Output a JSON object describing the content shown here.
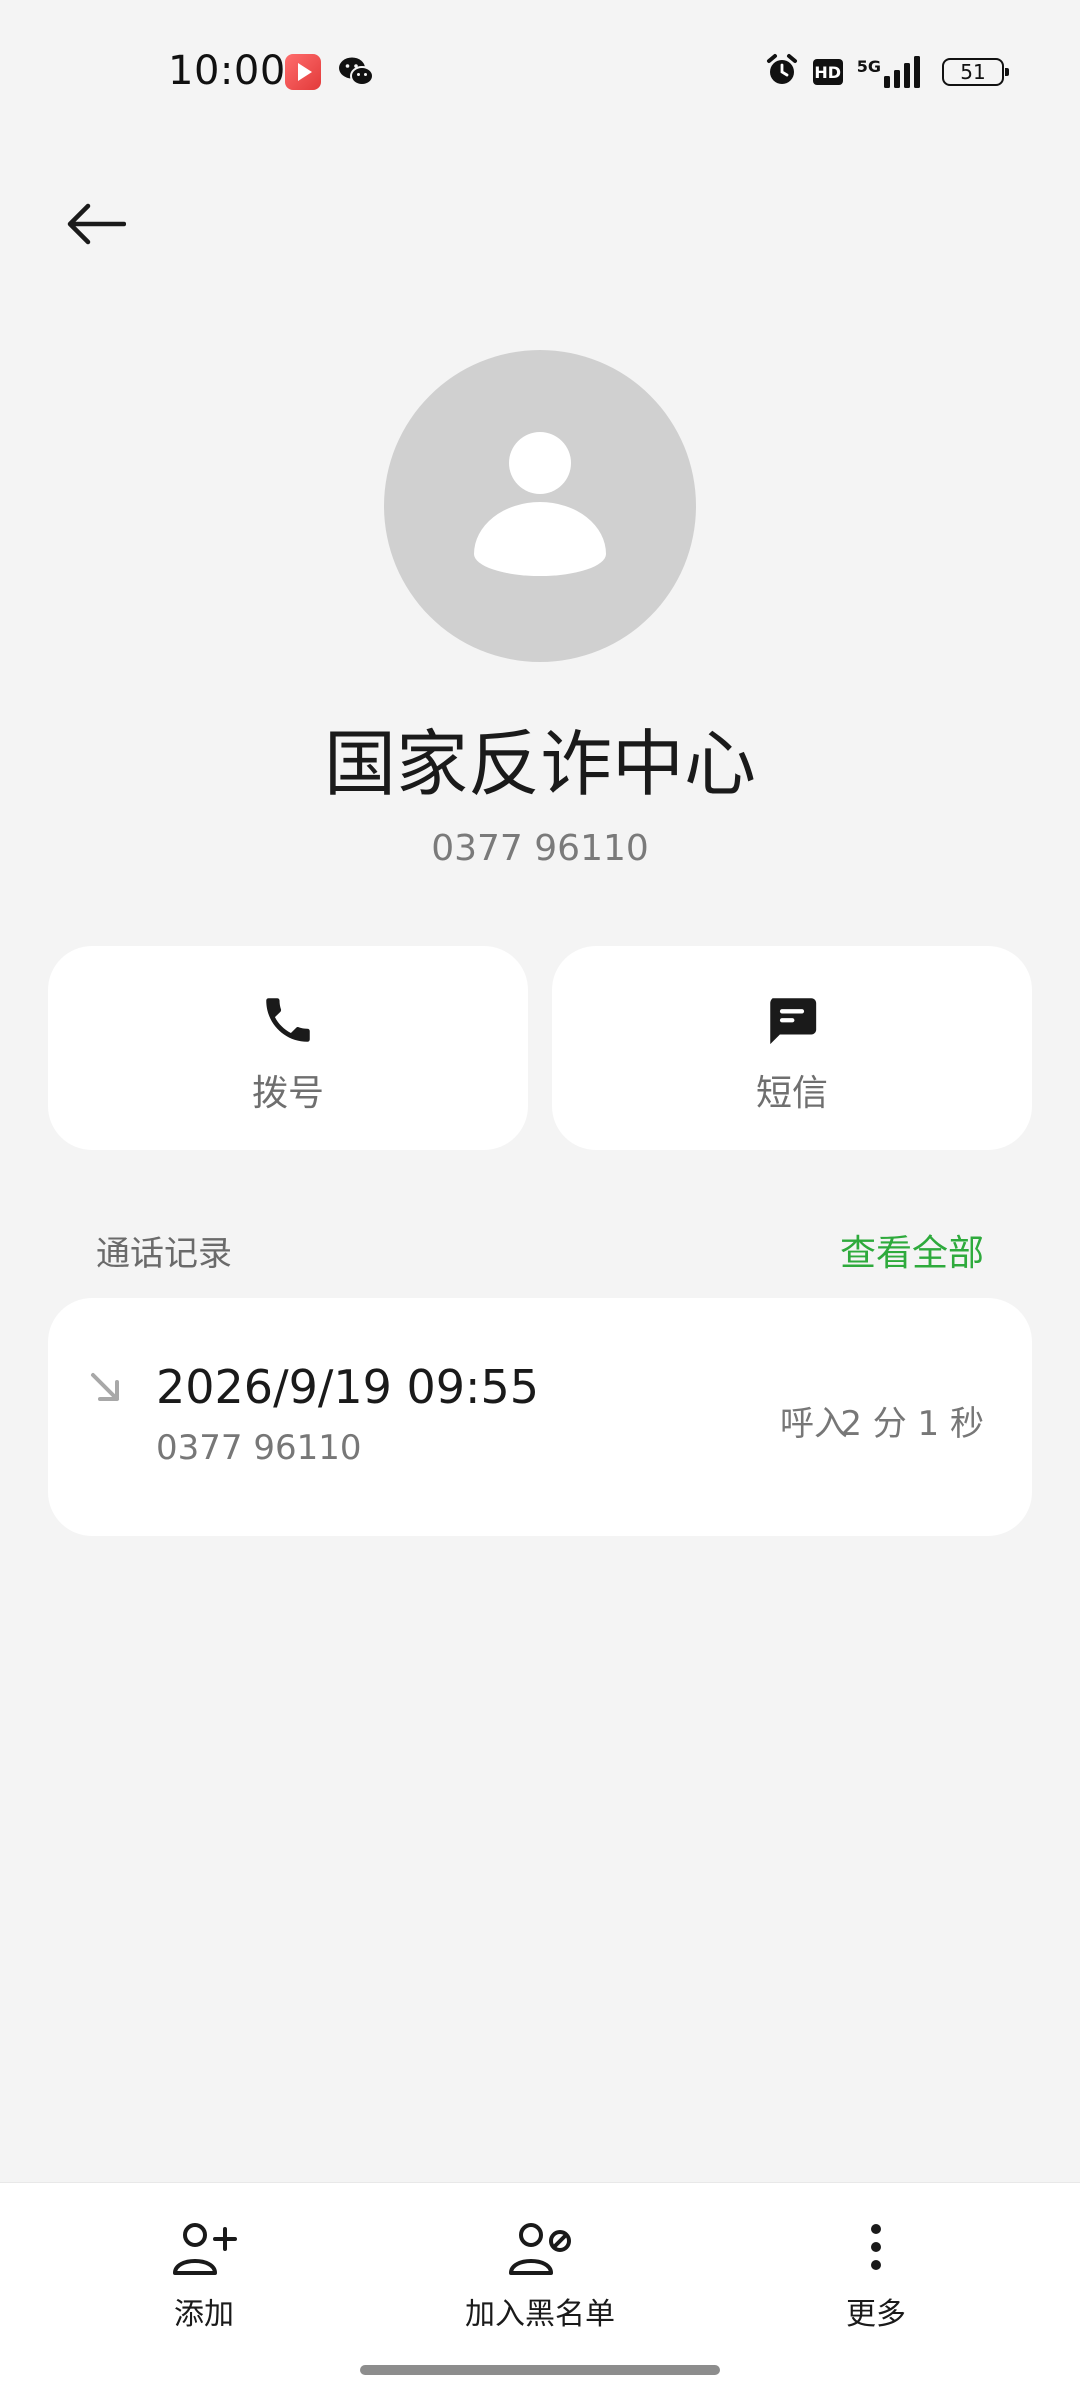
{
  "status_bar": {
    "time": "10:00",
    "network": "5G",
    "hd": "HD",
    "battery": "51",
    "icons": [
      "video-app-icon",
      "wechat-icon",
      "alarm-icon",
      "hd-icon",
      "signal-icon",
      "battery-icon"
    ]
  },
  "contact": {
    "name": "国家反诈中心",
    "number": "0377 96110",
    "avatar_icon": "person-avatar-icon"
  },
  "actions": {
    "dial_label": "拨号",
    "sms_label": "短信"
  },
  "call_log": {
    "title": "通话记录",
    "view_all": "查看全部",
    "entries": [
      {
        "datetime": "2026/9/19 09:55",
        "number": "0377 96110",
        "type": "呼入",
        "duration": "2 分 1 秒",
        "direction_icon": "incoming-call-arrow-icon"
      }
    ]
  },
  "bottom_bar": {
    "add_label": "添加",
    "block_label": "加入黑名单",
    "more_label": "更多"
  },
  "colors": {
    "background": "#f4f4f4",
    "card": "#ffffff",
    "accent_green": "#2eaa3c",
    "avatar_bg": "#d0d0d0"
  }
}
